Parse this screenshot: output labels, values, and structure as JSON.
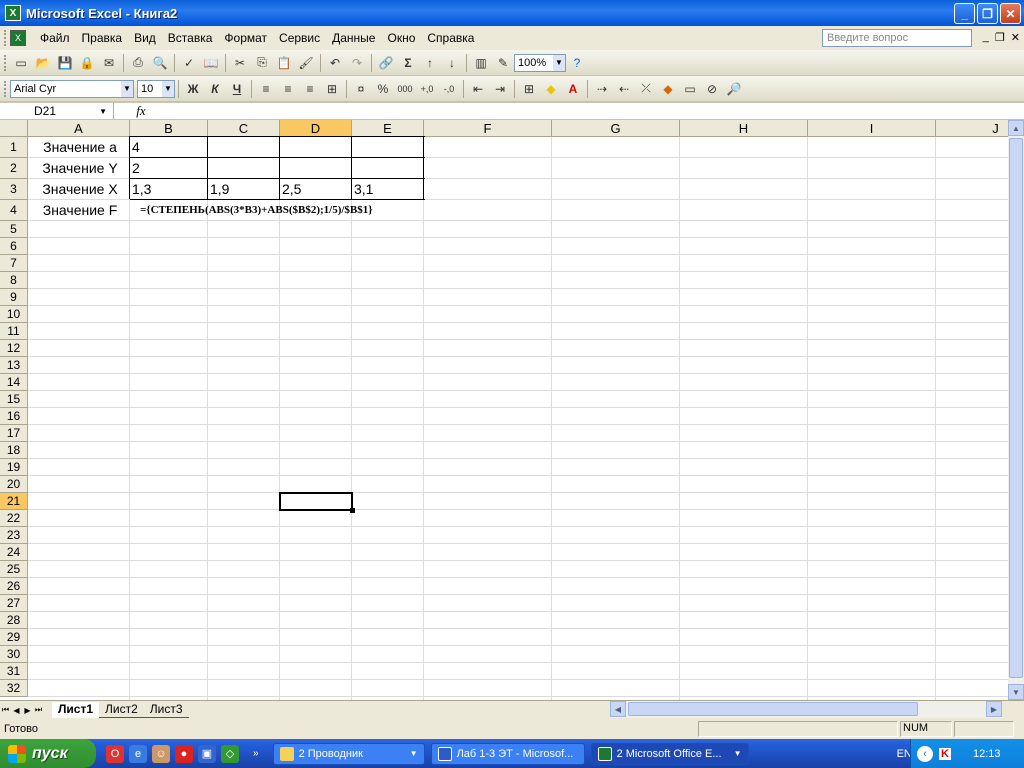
{
  "window": {
    "title": "Microsoft Excel - Книга2"
  },
  "menu": {
    "items": [
      "Файл",
      "Правка",
      "Вид",
      "Вставка",
      "Формат",
      "Сервис",
      "Данные",
      "Окно",
      "Справка"
    ],
    "ask_placeholder": "Введите вопрос"
  },
  "toolbar": {
    "zoom": "100%",
    "font": "Arial Cyr",
    "font_size": "10",
    "bold": "Ж",
    "italic": "К",
    "underline": "Ч",
    "percent": "%",
    "thousands": "000"
  },
  "formula_bar": {
    "name_box": "D21",
    "fx": "fx",
    "content": ""
  },
  "sheet": {
    "columns": [
      "A",
      "B",
      "C",
      "D",
      "E",
      "F",
      "G",
      "H",
      "I",
      "J"
    ],
    "rows": [
      "1",
      "2",
      "3",
      "4",
      "5",
      "6",
      "7",
      "8",
      "9",
      "10",
      "11",
      "12",
      "13",
      "14",
      "15",
      "16",
      "17",
      "18",
      "19",
      "20",
      "21",
      "22",
      "23",
      "24",
      "25",
      "26",
      "27",
      "28",
      "29",
      "30",
      "31",
      "32"
    ],
    "active_cell": "D21",
    "cells": {
      "A1": "Значение а",
      "B1": "4",
      "A2": "Значение Y",
      "B2": "2",
      "A3": "Значение X",
      "B3": "1,3",
      "C3": "1,9",
      "D3": "2,5",
      "E3": "3,1",
      "A4": "Значение F",
      "B4": "={СТЕПЕНЬ(ABS(3*B3)+ABS($B$2);1/5)/$B$1}"
    }
  },
  "sheet_tabs": [
    "Лист1",
    "Лист2",
    "Лист3"
  ],
  "status": {
    "text": "Готово",
    "num": "NUM"
  },
  "taskbar": {
    "start": "пуск",
    "tasks": [
      "2 Проводник",
      "Лаб 1-3 ЭТ - Microsof...",
      "2 Microsoft Office E..."
    ],
    "lang": "EN",
    "clock": "12:13"
  }
}
